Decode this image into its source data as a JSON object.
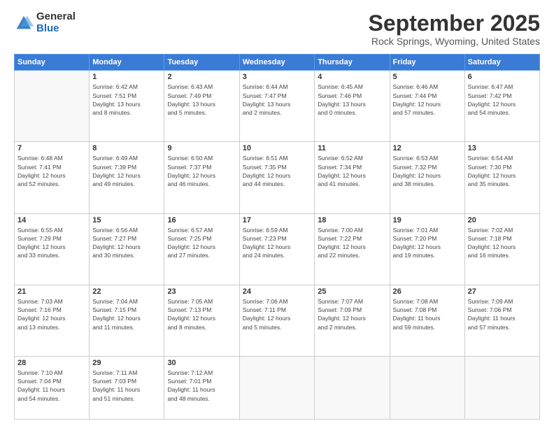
{
  "logo": {
    "general": "General",
    "blue": "Blue"
  },
  "header": {
    "month": "September 2025",
    "location": "Rock Springs, Wyoming, United States"
  },
  "weekdays": [
    "Sunday",
    "Monday",
    "Tuesday",
    "Wednesday",
    "Thursday",
    "Friday",
    "Saturday"
  ],
  "weeks": [
    [
      {
        "day": "",
        "info": ""
      },
      {
        "day": "1",
        "info": "Sunrise: 6:42 AM\nSunset: 7:51 PM\nDaylight: 13 hours\nand 8 minutes."
      },
      {
        "day": "2",
        "info": "Sunrise: 6:43 AM\nSunset: 7:49 PM\nDaylight: 13 hours\nand 5 minutes."
      },
      {
        "day": "3",
        "info": "Sunrise: 6:44 AM\nSunset: 7:47 PM\nDaylight: 13 hours\nand 2 minutes."
      },
      {
        "day": "4",
        "info": "Sunrise: 6:45 AM\nSunset: 7:46 PM\nDaylight: 13 hours\nand 0 minutes."
      },
      {
        "day": "5",
        "info": "Sunrise: 6:46 AM\nSunset: 7:44 PM\nDaylight: 12 hours\nand 57 minutes."
      },
      {
        "day": "6",
        "info": "Sunrise: 6:47 AM\nSunset: 7:42 PM\nDaylight: 12 hours\nand 54 minutes."
      }
    ],
    [
      {
        "day": "7",
        "info": "Sunrise: 6:48 AM\nSunset: 7:41 PM\nDaylight: 12 hours\nand 52 minutes."
      },
      {
        "day": "8",
        "info": "Sunrise: 6:49 AM\nSunset: 7:39 PM\nDaylight: 12 hours\nand 49 minutes."
      },
      {
        "day": "9",
        "info": "Sunrise: 6:50 AM\nSunset: 7:37 PM\nDaylight: 12 hours\nand 46 minutes."
      },
      {
        "day": "10",
        "info": "Sunrise: 6:51 AM\nSunset: 7:35 PM\nDaylight: 12 hours\nand 44 minutes."
      },
      {
        "day": "11",
        "info": "Sunrise: 6:52 AM\nSunset: 7:34 PM\nDaylight: 12 hours\nand 41 minutes."
      },
      {
        "day": "12",
        "info": "Sunrise: 6:53 AM\nSunset: 7:32 PM\nDaylight: 12 hours\nand 38 minutes."
      },
      {
        "day": "13",
        "info": "Sunrise: 6:54 AM\nSunset: 7:30 PM\nDaylight: 12 hours\nand 35 minutes."
      }
    ],
    [
      {
        "day": "14",
        "info": "Sunrise: 6:55 AM\nSunset: 7:29 PM\nDaylight: 12 hours\nand 33 minutes."
      },
      {
        "day": "15",
        "info": "Sunrise: 6:56 AM\nSunset: 7:27 PM\nDaylight: 12 hours\nand 30 minutes."
      },
      {
        "day": "16",
        "info": "Sunrise: 6:57 AM\nSunset: 7:25 PM\nDaylight: 12 hours\nand 27 minutes."
      },
      {
        "day": "17",
        "info": "Sunrise: 6:59 AM\nSunset: 7:23 PM\nDaylight: 12 hours\nand 24 minutes."
      },
      {
        "day": "18",
        "info": "Sunrise: 7:00 AM\nSunset: 7:22 PM\nDaylight: 12 hours\nand 22 minutes."
      },
      {
        "day": "19",
        "info": "Sunrise: 7:01 AM\nSunset: 7:20 PM\nDaylight: 12 hours\nand 19 minutes."
      },
      {
        "day": "20",
        "info": "Sunrise: 7:02 AM\nSunset: 7:18 PM\nDaylight: 12 hours\nand 16 minutes."
      }
    ],
    [
      {
        "day": "21",
        "info": "Sunrise: 7:03 AM\nSunset: 7:16 PM\nDaylight: 12 hours\nand 13 minutes."
      },
      {
        "day": "22",
        "info": "Sunrise: 7:04 AM\nSunset: 7:15 PM\nDaylight: 12 hours\nand 11 minutes."
      },
      {
        "day": "23",
        "info": "Sunrise: 7:05 AM\nSunset: 7:13 PM\nDaylight: 12 hours\nand 8 minutes."
      },
      {
        "day": "24",
        "info": "Sunrise: 7:06 AM\nSunset: 7:11 PM\nDaylight: 12 hours\nand 5 minutes."
      },
      {
        "day": "25",
        "info": "Sunrise: 7:07 AM\nSunset: 7:09 PM\nDaylight: 12 hours\nand 2 minutes."
      },
      {
        "day": "26",
        "info": "Sunrise: 7:08 AM\nSunset: 7:08 PM\nDaylight: 11 hours\nand 59 minutes."
      },
      {
        "day": "27",
        "info": "Sunrise: 7:09 AM\nSunset: 7:06 PM\nDaylight: 11 hours\nand 57 minutes."
      }
    ],
    [
      {
        "day": "28",
        "info": "Sunrise: 7:10 AM\nSunset: 7:04 PM\nDaylight: 11 hours\nand 54 minutes."
      },
      {
        "day": "29",
        "info": "Sunrise: 7:11 AM\nSunset: 7:03 PM\nDaylight: 11 hours\nand 51 minutes."
      },
      {
        "day": "30",
        "info": "Sunrise: 7:12 AM\nSunset: 7:01 PM\nDaylight: 11 hours\nand 48 minutes."
      },
      {
        "day": "",
        "info": ""
      },
      {
        "day": "",
        "info": ""
      },
      {
        "day": "",
        "info": ""
      },
      {
        "day": "",
        "info": ""
      }
    ]
  ]
}
